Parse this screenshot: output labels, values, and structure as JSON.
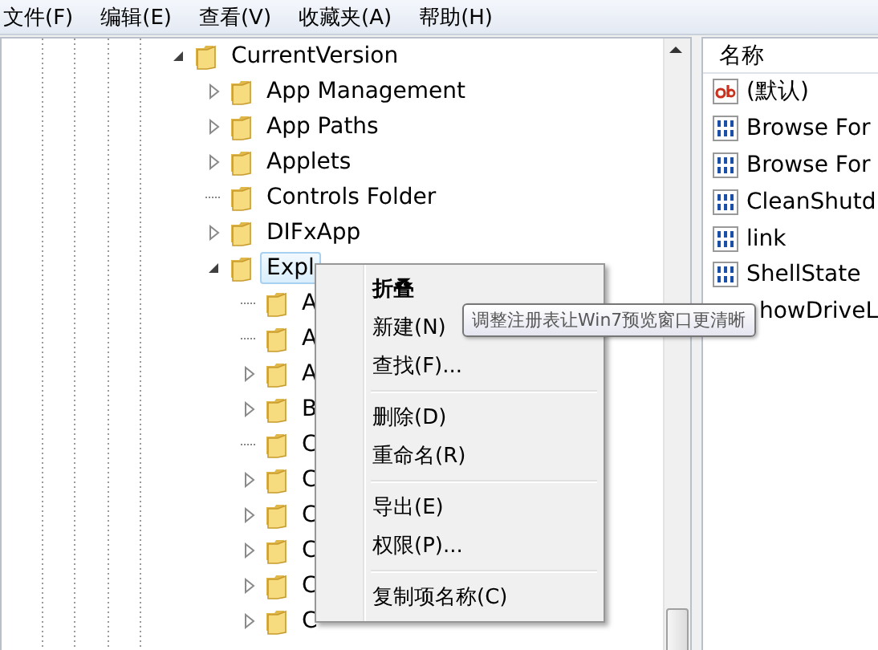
{
  "menu_bar": [
    "文件(F)",
    "编辑(E)",
    "查看(V)",
    "收藏夹(A)",
    "帮助(H)"
  ],
  "tree": [
    {
      "label": "CurrentVersion",
      "expanded": true,
      "selected": false,
      "children": [
        {
          "label": "App Management",
          "expanded": false,
          "selected": false
        },
        {
          "label": "App Paths",
          "expanded": false,
          "selected": false
        },
        {
          "label": "Applets",
          "expanded": false,
          "selected": false
        },
        {
          "label": "Controls Folder",
          "selected": false
        },
        {
          "label": "DIFxApp",
          "expanded": false,
          "selected": false
        },
        {
          "label": "Expl",
          "expanded": true,
          "selected": true,
          "children": [
            {
              "label": "A",
              "selected": false
            },
            {
              "label": "A",
              "selected": false
            },
            {
              "label": "A",
              "expanded": false,
              "selected": false
            },
            {
              "label": "B",
              "expanded": false,
              "selected": false
            },
            {
              "label": "C",
              "selected": false
            },
            {
              "label": "C",
              "expanded": false,
              "selected": false
            },
            {
              "label": "C",
              "expanded": false,
              "selected": false
            },
            {
              "label": "C",
              "expanded": false,
              "selected": false
            },
            {
              "label": "C",
              "expanded": false,
              "selected": false
            },
            {
              "label": "C",
              "expanded": false,
              "selected": false
            }
          ]
        }
      ]
    }
  ],
  "values_panel": {
    "column": "名称",
    "rows": [
      {
        "name": "(默认)",
        "kind": "string"
      },
      {
        "name": "Browse For",
        "kind": "binary"
      },
      {
        "name": "Browse For",
        "kind": "binary"
      },
      {
        "name": "CleanShutd",
        "kind": "binary"
      },
      {
        "name": "link",
        "kind": "binary"
      },
      {
        "name": "ShellState",
        "kind": "binary"
      },
      {
        "name": "howDriveL",
        "kind": "covered"
      }
    ]
  },
  "context_menu": [
    {
      "label": "折叠",
      "kind": "default"
    },
    {
      "label": "新建(N)",
      "kind": "item"
    },
    {
      "label": "查找(F)...",
      "kind": "item"
    },
    {
      "kind": "separator"
    },
    {
      "label": "删除(D)",
      "kind": "item"
    },
    {
      "label": "重命名(R)",
      "kind": "item"
    },
    {
      "kind": "separator"
    },
    {
      "label": "导出(E)",
      "kind": "item"
    },
    {
      "label": "权限(P)...",
      "kind": "item"
    },
    {
      "kind": "separator"
    },
    {
      "label": "复制项名称(C)",
      "kind": "item"
    }
  ],
  "tooltip": "调整注册表让Win7预览窗口更清晰"
}
